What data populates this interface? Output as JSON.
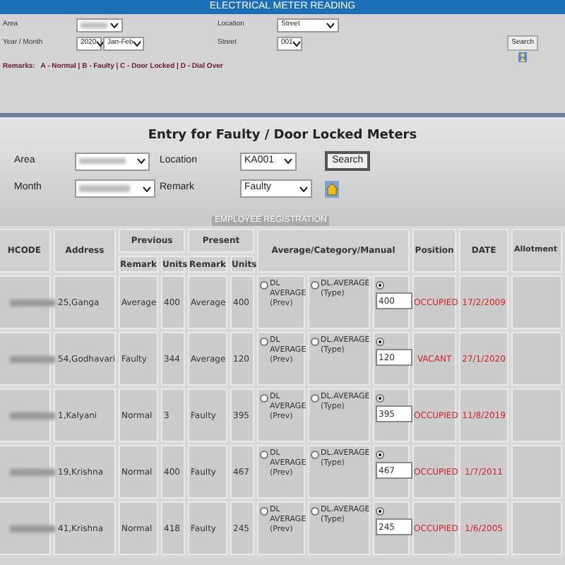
{
  "header": {
    "title": "ELECTRICAL METER READING"
  },
  "filter_panel": {
    "area": {
      "label": "Area",
      "value_hidden": true
    },
    "year_month": {
      "label": "Year / Month",
      "year": "2020",
      "month": "Jan-Feb"
    },
    "location": {
      "label": "Location",
      "value": "Street"
    },
    "street": {
      "label": "Street",
      "value": "001"
    },
    "search_button": "Search",
    "remarks_label": "Remarks:",
    "remarks_text": "A - Normal | B - Faulty | C - Door Locked | D - Dial Over"
  },
  "entry_panel": {
    "title": "Entry for Faulty / Door Locked Meters",
    "area": {
      "label": "Area",
      "value_hidden": true
    },
    "month": {
      "label": "Month",
      "value_hidden": true
    },
    "location": {
      "label": "Location",
      "value": "KA001"
    },
    "remark": {
      "label": "Remark",
      "value": "Faulty"
    },
    "search_button": "Search"
  },
  "overlay_label": "EMPLOYEE REGISTRATION",
  "table": {
    "columns": [
      "HCODE",
      "Address",
      "Previous",
      "Present",
      "Average/Category/Manual",
      "Position",
      "DATE",
      "Allotment"
    ],
    "subcolumns": [
      "Remark",
      "Units",
      "Remark",
      "Units"
    ],
    "rows": [
      {
        "hcode_hidden": true,
        "address": "25,Ganga",
        "prev_remark": "Average",
        "prev_units": "400",
        "present_remark": "Average",
        "present_units": "400",
        "options": [
          {
            "label": "DL AVERAGE (Prev)",
            "selected": false
          },
          {
            "label": "DL.AVERAGE (Type)",
            "selected": false
          },
          {
            "selected": true
          }
        ],
        "manual_value": "400",
        "position": "OCCUPIED",
        "date": "17/2/2009"
      },
      {
        "hcode_hidden": true,
        "address": "54,Godhavari",
        "prev_remark": "Faulty",
        "prev_units": "344",
        "present_remark": "Average",
        "present_units": "120",
        "options": [
          {
            "label": "DL AVERAGE (Prev)",
            "selected": false
          },
          {
            "label": "DL.AVERAGE (Type)",
            "selected": false
          },
          {
            "selected": true
          }
        ],
        "manual_value": "120",
        "position": "VACANT",
        "date": "27/1/2020"
      },
      {
        "hcode_hidden": true,
        "address": "1,Kalyani",
        "prev_remark": "Normal",
        "prev_units": "3",
        "present_remark": "Faulty",
        "present_units": "395",
        "options": [
          {
            "label": "DL AVERAGE (Prev)",
            "selected": false
          },
          {
            "label": "DL.AVERAGE (Type)",
            "selected": false
          },
          {
            "selected": true
          }
        ],
        "manual_value": "395",
        "position": "OCCUPIED",
        "date": "11/8/2019"
      },
      {
        "hcode_hidden": true,
        "address": "19,Krishna",
        "prev_remark": "Normal",
        "prev_units": "400",
        "present_remark": "Faulty",
        "present_units": "467",
        "options": [
          {
            "label": "DL AVERAGE (Prev)",
            "selected": false
          },
          {
            "label": "DL.AVERAGE (Type)",
            "selected": false
          },
          {
            "selected": true
          }
        ],
        "manual_value": "467",
        "position": "OCCUPIED",
        "date": "1/7/2011"
      },
      {
        "hcode_hidden": true,
        "address": "41,Krishna",
        "prev_remark": "Normal",
        "prev_units": "418",
        "present_remark": "Faulty",
        "present_units": "245",
        "options": [
          {
            "label": "DL AVERAGE (Prev)",
            "selected": false
          },
          {
            "label": "DL.AVERAGE (Type)",
            "selected": false
          },
          {
            "selected": true
          }
        ],
        "manual_value": "245",
        "position": "OCCUPIED",
        "date": "1/6/2005"
      }
    ]
  }
}
